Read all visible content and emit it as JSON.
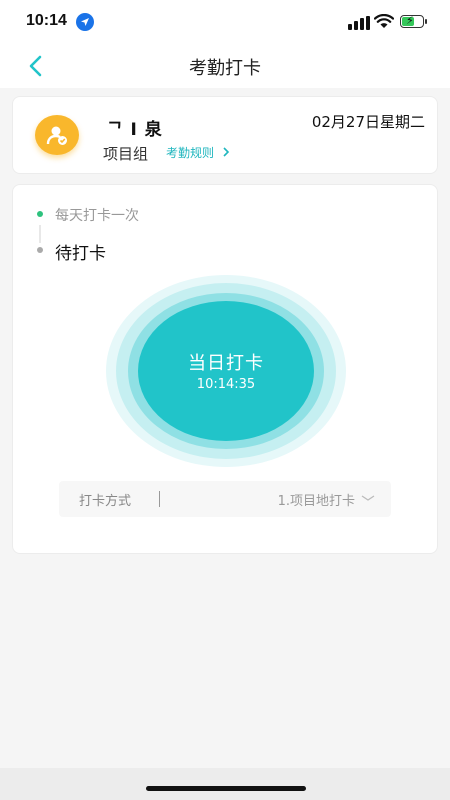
{
  "status_bar": {
    "time": "10:14"
  },
  "nav": {
    "title": "考勤打卡"
  },
  "user_card": {
    "name": "ᄀ I 泉",
    "group": "项目组",
    "rules_link": "考勤规则",
    "date": "02月27日星期二"
  },
  "punch": {
    "frequency": "每天打卡一次",
    "status": "待打卡",
    "button_label": "当日打卡",
    "button_time": "10:14:35"
  },
  "method": {
    "label": "打卡方式",
    "value": "1.项目地打卡"
  },
  "colors": {
    "accent": "#21c4c9",
    "avatar": "#f9b72c",
    "active_dot": "#2ec27e"
  },
  "icons": {
    "back": "chevron-left-icon",
    "rules": "chevron-right-icon",
    "method": "chevron-down-icon",
    "avatar": "user-check-icon"
  }
}
